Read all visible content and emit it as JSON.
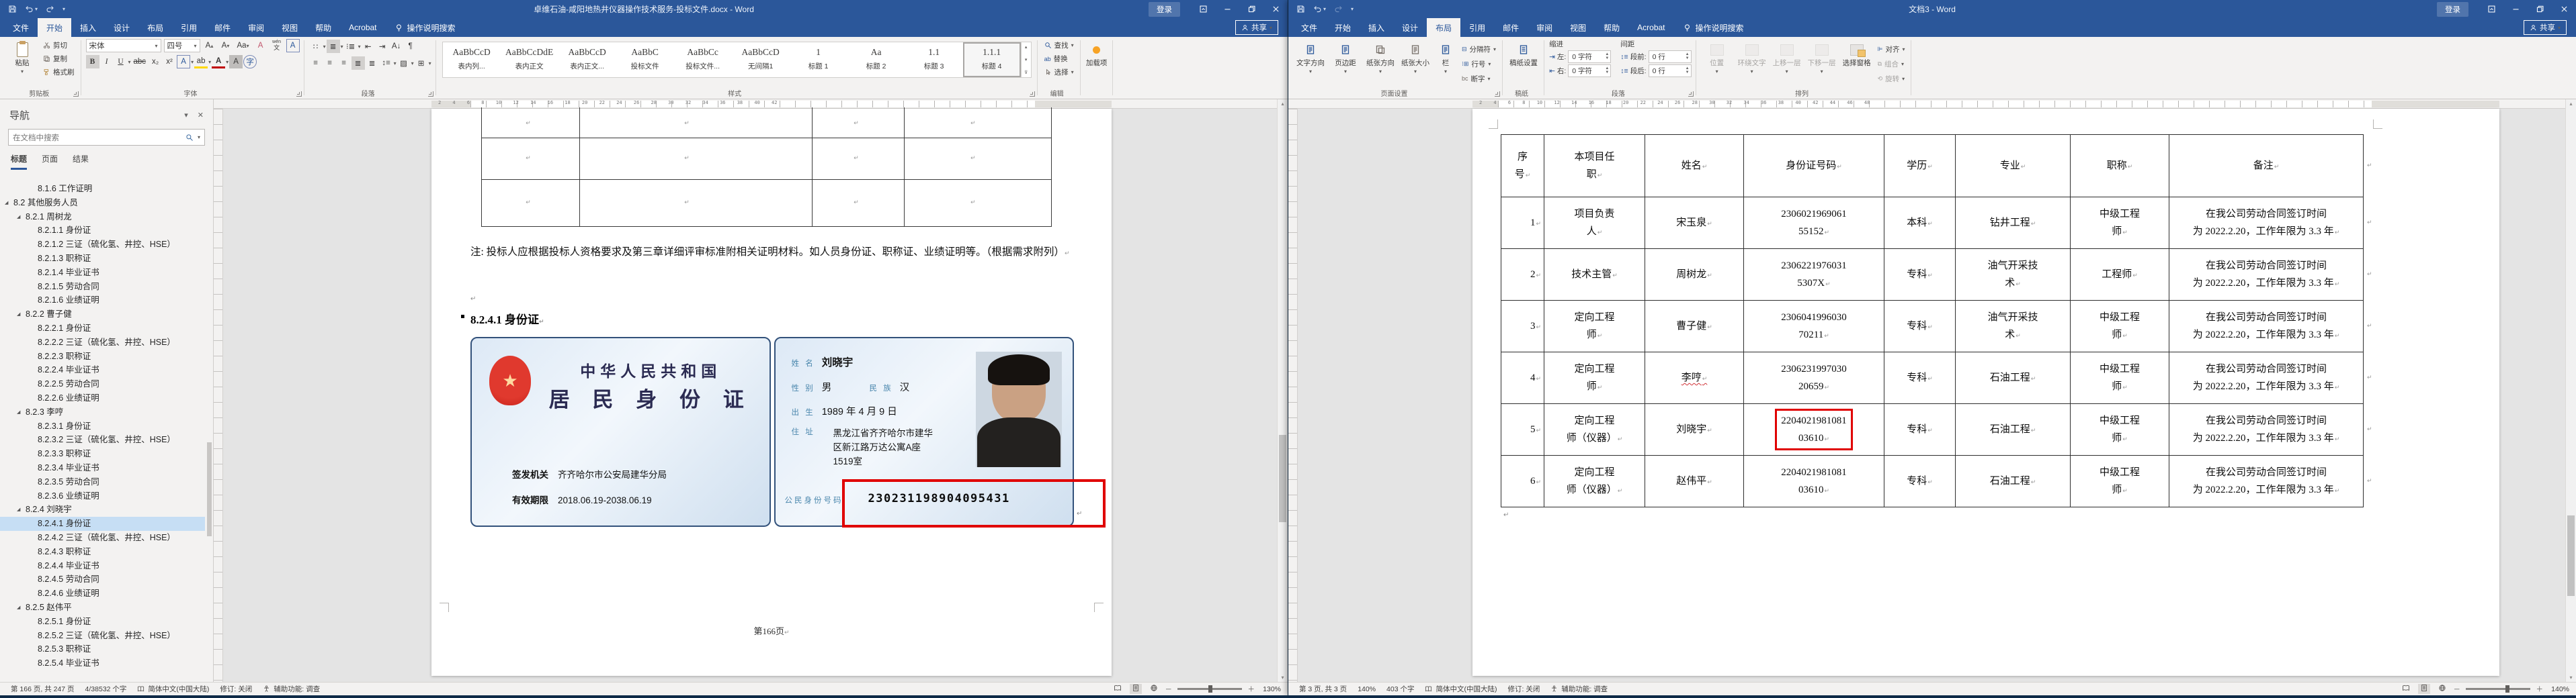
{
  "chrome": {
    "signin": "登录",
    "share": "共享",
    "search_tab": "操作说明搜索"
  },
  "left": {
    "title": "卓维石油-咸阳地热井仪器操作技术服务-投标文件.docx  -  Word",
    "tabs": [
      {
        "t": "文件"
      },
      {
        "t": "开始",
        "cls": "active"
      },
      {
        "t": "插入"
      },
      {
        "t": "设计"
      },
      {
        "t": "布局"
      },
      {
        "t": "引用"
      },
      {
        "t": "邮件"
      },
      {
        "t": "审阅"
      },
      {
        "t": "视图"
      },
      {
        "t": "帮助"
      },
      {
        "t": "Acrobat"
      }
    ],
    "ribbon": {
      "paste": "粘贴",
      "cut": "剪切",
      "copy": "复制",
      "painter": "格式刷",
      "clipboard_label": "剪贴板",
      "font_name": "宋体",
      "font_size": "四号",
      "font_label": "字体",
      "para_label": "段落",
      "styles": [
        {
          "p": "AaBbCcD",
          "l": "表内列..."
        },
        {
          "p": "AaBbCcDdE",
          "l": "表内正文"
        },
        {
          "p": "AaBbCcD",
          "l": "表内正文..."
        },
        {
          "p": "AaBbC",
          "l": "投标文件"
        },
        {
          "p": "AaBbCc",
          "l": "投标文件..."
        },
        {
          "p": "AaBbCcD",
          "l": "无间隔1"
        },
        {
          "p": "1",
          "l": "标题 1"
        },
        {
          "p": "Aa",
          "l": "标题 2"
        },
        {
          "p": "1.1",
          "l": "标题 3"
        },
        {
          "p": "1.1.1",
          "l": "标题 4",
          "cls": "sel"
        }
      ],
      "styles_label": "样式",
      "find": "查找",
      "replace": "替换",
      "select": "选择",
      "edit_label": "编辑",
      "addins": "加载项"
    },
    "nav": {
      "title": "导航",
      "placeholder": "在文档中搜索",
      "tabs": [
        {
          "t": "标题",
          "cls": "active"
        },
        {
          "t": "页面"
        },
        {
          "t": "结果"
        }
      ],
      "items": [
        {
          "t": "8.1.6 工作证明",
          "cls": "lvl3"
        },
        {
          "t": "8.2 其他服务人员",
          "cls": "lvl1 tri"
        },
        {
          "t": "8.2.1 周树龙",
          "cls": "lvl2 tri"
        },
        {
          "t": "8.2.1.1 身份证",
          "cls": "lvl3"
        },
        {
          "t": "8.2.1.2 三证（硫化氢、井控、HSE）",
          "cls": "lvl3"
        },
        {
          "t": "8.2.1.3 职称证",
          "cls": "lvl3"
        },
        {
          "t": "8.2.1.4 毕业证书",
          "cls": "lvl3"
        },
        {
          "t": "8.2.1.5 劳动合同",
          "cls": "lvl3"
        },
        {
          "t": "8.2.1.6 业绩证明",
          "cls": "lvl3"
        },
        {
          "t": "8.2.2 曹子健",
          "cls": "lvl2 tri"
        },
        {
          "t": "8.2.2.1 身份证",
          "cls": "lvl3"
        },
        {
          "t": "8.2.2.2 三证（硫化氢、井控、HSE）",
          "cls": "lvl3"
        },
        {
          "t": "8.2.2.3 职称证",
          "cls": "lvl3"
        },
        {
          "t": "8.2.2.4 毕业证书",
          "cls": "lvl3"
        },
        {
          "t": "8.2.2.5 劳动合同",
          "cls": "lvl3"
        },
        {
          "t": "8.2.2.6 业绩证明",
          "cls": "lvl3"
        },
        {
          "t": "8.2.3 李哼",
          "cls": "lvl2 tri"
        },
        {
          "t": "8.2.3.1 身份证",
          "cls": "lvl3"
        },
        {
          "t": "8.2.3.2 三证（硫化氢、井控、HSE）",
          "cls": "lvl3"
        },
        {
          "t": "8.2.3.3 职称证",
          "cls": "lvl3"
        },
        {
          "t": "8.2.3.4 毕业证书",
          "cls": "lvl3"
        },
        {
          "t": "8.2.3.5 劳动合同",
          "cls": "lvl3"
        },
        {
          "t": "8.2.3.6 业绩证明",
          "cls": "lvl3"
        },
        {
          "t": "8.2.4 刘晓宇",
          "cls": "lvl2 tri"
        },
        {
          "t": "8.2.4.1 身份证",
          "cls": "lvl3 sel"
        },
        {
          "t": "8.2.4.2 三证（硫化氢、井控、HSE）",
          "cls": "lvl3"
        },
        {
          "t": "8.2.4.3 职称证",
          "cls": "lvl3"
        },
        {
          "t": "8.2.4.4 毕业证书",
          "cls": "lvl3"
        },
        {
          "t": "8.2.4.5 劳动合同",
          "cls": "lvl3"
        },
        {
          "t": "8.2.4.6 业绩证明",
          "cls": "lvl3"
        },
        {
          "t": "8.2.5 赵伟平",
          "cls": "lvl2 tri"
        },
        {
          "t": "8.2.5.1 身份证",
          "cls": "lvl3"
        },
        {
          "t": "8.2.5.2 三证（硫化氢、井控、HSE）",
          "cls": "lvl3"
        },
        {
          "t": "8.2.5.3 职称证",
          "cls": "lvl3"
        },
        {
          "t": "8.2.5.4 毕业证书",
          "cls": "lvl3"
        }
      ]
    },
    "ruler": "2 4 6 8 10 12 14 16 18 20 22 24 26 28 30 32 34 36 38 40 42",
    "doc": {
      "note": "注: 投标人应根据投标人资格要求及第三章详细评审标准附相关证明材料。如人员身份证、职称证、业绩证明等。（根据需求附列）",
      "heading": "8.2.4.1  身份证",
      "card": {
        "country": "中华人民共和国",
        "title": "居 民 身 份 证",
        "issuer_label": "签发机关",
        "issuer": "齐齐哈尔市公安局建华分局",
        "valid_label": "有效期限",
        "valid": "2018.06.19-2038.06.19",
        "name_label": "姓 名",
        "name": "刘晓宇",
        "sex_label": "性 别",
        "sex": "男",
        "eth_label": "民 族",
        "eth": "汉",
        "birth_label": "出 生",
        "birth": "1989 年 4 月 9 日",
        "addr_label": "住 址",
        "addr1": "黑龙江省齐齐哈尔市建华",
        "addr2": "区新江路万达公寓A座",
        "addr3": "1519室",
        "idno_label": "公民身份号码",
        "idno": "230231198904095431"
      },
      "pagenum": "第166页"
    },
    "status": {
      "page": "第 166 页, 共 247 页",
      "words": "4/38532 个字",
      "lang": "简体中文(中国大陆)",
      "track": "修订: 关闭",
      "access": "辅助功能: 调查",
      "zoom": "130%"
    }
  },
  "right": {
    "title": "文档3  -  Word",
    "tabs": [
      {
        "t": "文件"
      },
      {
        "t": "开始"
      },
      {
        "t": "插入"
      },
      {
        "t": "设计"
      },
      {
        "t": "布局",
        "cls": "active"
      },
      {
        "t": "引用"
      },
      {
        "t": "邮件"
      },
      {
        "t": "审阅"
      },
      {
        "t": "视图"
      },
      {
        "t": "帮助"
      },
      {
        "t": "Acrobat"
      }
    ],
    "ribbon": {
      "textdir": "文字方向",
      "margins": "页边距",
      "orient": "纸张方向",
      "size": "纸张大小",
      "cols": "栏",
      "breaks": "分隔符",
      "linenum": "行号",
      "hyph": "断字",
      "pagesetup_label": "页面设置",
      "grid": "稿纸设置",
      "grid_label": "稿纸",
      "indent": "缩进",
      "left": "左:",
      "right": "右:",
      "chars": "0 字符",
      "spacing": "间距",
      "before": "段前:",
      "after": "段后:",
      "lines": "0 行",
      "para_label": "段落",
      "pos": "位置",
      "wrap": "环绕文字",
      "fwd": "上移一层",
      "back": "下移一层",
      "pane": "选择窗格",
      "align": "对齐",
      "group": "组合",
      "rotate": "旋转",
      "arrange_label": "排列"
    },
    "ruler": "2 4 6 8 10 12 14 16 18 20 22 24 26 28 30 32 34 36 38 40 42 44 46 48",
    "table": {
      "headers": [
        "序\n号",
        "本项目任\n职",
        "姓名",
        "身份证号码",
        "学历",
        "专业",
        "职称",
        "备注"
      ],
      "rows": [
        {
          "n": "1",
          "r": "项目负责\n人",
          "x": "宋玉泉",
          "id": "2306021969061\n55152",
          "xl": "本科",
          "zy": "钻井工程",
          "zc": "中级工程\n师",
          "bz": "在我公司劳动合同签订时间\n为 2022.2.20，工作年限为 3.3 年"
        },
        {
          "n": "2",
          "r": "技术主管",
          "x": "周树龙",
          "id": "2306221976031\n5307X",
          "xl": "专科",
          "zy": "油气开采技\n术",
          "zc": "工程师",
          "bz": "在我公司劳动合同签订时间\n为 2022.2.20，工作年限为 3.3 年"
        },
        {
          "n": "3",
          "r": "定向工程\n师",
          "x": "曹子健",
          "id": "2306041996030\n70211",
          "xl": "专科",
          "zy": "油气开采技\n术",
          "zc": "中级工程\n师",
          "bz": "在我公司劳动合同签订时间\n为 2022.2.20，工作年限为 3.3 年"
        },
        {
          "n": "4",
          "r": "定向工程\n师",
          "x": "李哼",
          "xcls": "squig",
          "id": "2306231997030\n20659",
          "xl": "专科",
          "zy": "石油工程",
          "zc": "中级工程\n师",
          "bz": "在我公司劳动合同签订时间\n为 2022.2.20，工作年限为 3.3 年"
        },
        {
          "n": "5",
          "r": "定向工程\n师（仪器）",
          "x": "刘晓宇",
          "id": "2204021981081\n03610",
          "idcls": "redbox",
          "xl": "专科",
          "zy": "石油工程",
          "zc": "中级工程\n师",
          "bz": "在我公司劳动合同签订时间\n为 2022.2.20，工作年限为 3.3 年"
        },
        {
          "n": "6",
          "r": "定向工程\n师（仪器）",
          "x": "赵伟平",
          "id": "2204021981081\n03610",
          "xl": "专科",
          "zy": "石油工程",
          "zc": "中级工程\n师",
          "bz": "在我公司劳动合同签订时间\n为 2022.2.20，工作年限为 3.3 年"
        }
      ]
    },
    "status": {
      "page": "第 3 页, 共 3 页",
      "zoom_inline": "140%",
      "words": "403 个字",
      "lang": "简体中文(中国大陆)",
      "track": "修订: 关闭",
      "access": "辅助功能: 调查",
      "zoom": "140%"
    }
  }
}
